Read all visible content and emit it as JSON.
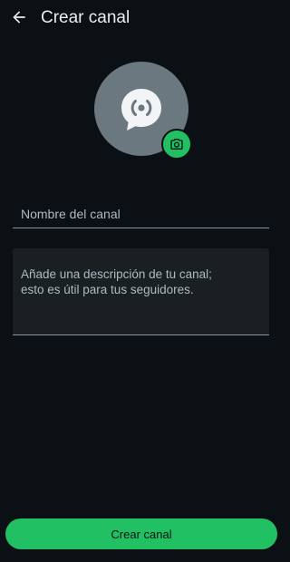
{
  "app_bar": {
    "title": "Crear canal"
  },
  "form": {
    "name_placeholder": "Nombre del canal",
    "name_value": "",
    "description_placeholder": "Añade una descripción de tu canal;\nesto es útil para tus seguidores.",
    "description_value": ""
  },
  "actions": {
    "create_label": "Crear canal"
  },
  "icons": {
    "back": "arrow-back-icon",
    "avatar": "channel-broadcast-icon",
    "camera": "camera-icon"
  },
  "colors": {
    "background": "#0b1014",
    "accent": "#21c063",
    "avatar": "#6b7880",
    "field_fill": "#1a1f22",
    "underline": "#8696a0"
  }
}
